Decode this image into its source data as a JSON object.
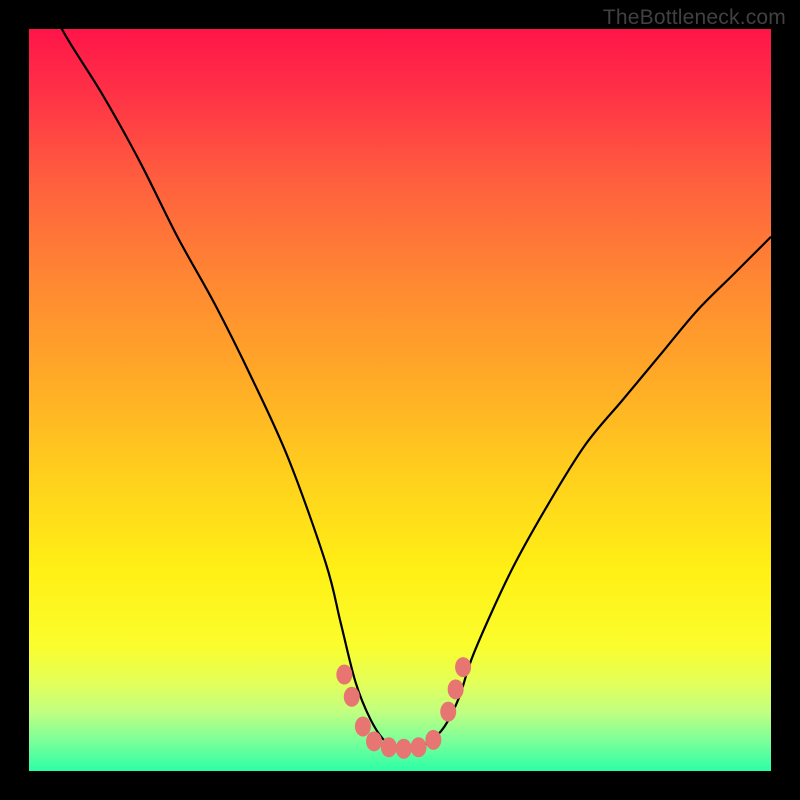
{
  "watermark": "TheBottleneck.com",
  "chart_data": {
    "type": "line",
    "title": "",
    "xlabel": "",
    "ylabel": "",
    "xlim": [
      0,
      100
    ],
    "ylim": [
      0,
      100
    ],
    "grid": false,
    "legend": false,
    "description": "V-shaped bottleneck curve over a red-to-green vertical gradient. Lower y is better (green). Pink markers indicate near-optimal region around the valley.",
    "series": [
      {
        "name": "bottleneck-curve",
        "x": [
          0,
          5,
          10,
          15,
          20,
          25,
          30,
          35,
          40,
          42,
          44,
          46,
          48,
          50,
          52,
          54,
          56,
          58,
          60,
          65,
          70,
          75,
          80,
          85,
          90,
          95,
          100
        ],
        "y": [
          108,
          99,
          91,
          82,
          72,
          63,
          53,
          42,
          28,
          20,
          12,
          7,
          4,
          3,
          3,
          4,
          6,
          10,
          16,
          27,
          36,
          44,
          50,
          56,
          62,
          67,
          72
        ]
      }
    ],
    "markers": [
      {
        "x": 42.5,
        "y": 13
      },
      {
        "x": 43.5,
        "y": 10
      },
      {
        "x": 45,
        "y": 6
      },
      {
        "x": 46.5,
        "y": 4
      },
      {
        "x": 48.5,
        "y": 3.2
      },
      {
        "x": 50.5,
        "y": 3
      },
      {
        "x": 52.5,
        "y": 3.2
      },
      {
        "x": 54.5,
        "y": 4.2
      },
      {
        "x": 56.5,
        "y": 8
      },
      {
        "x": 57.5,
        "y": 11
      },
      {
        "x": 58.5,
        "y": 14
      }
    ],
    "marker_color": "#e77572",
    "curve_color": "#000000",
    "gradient_stops": [
      {
        "pos": 0,
        "color": "#ff1549"
      },
      {
        "pos": 0.5,
        "color": "#ffaa27"
      },
      {
        "pos": 0.8,
        "color": "#fff015"
      },
      {
        "pos": 1.0,
        "color": "#2cffa6"
      }
    ]
  }
}
